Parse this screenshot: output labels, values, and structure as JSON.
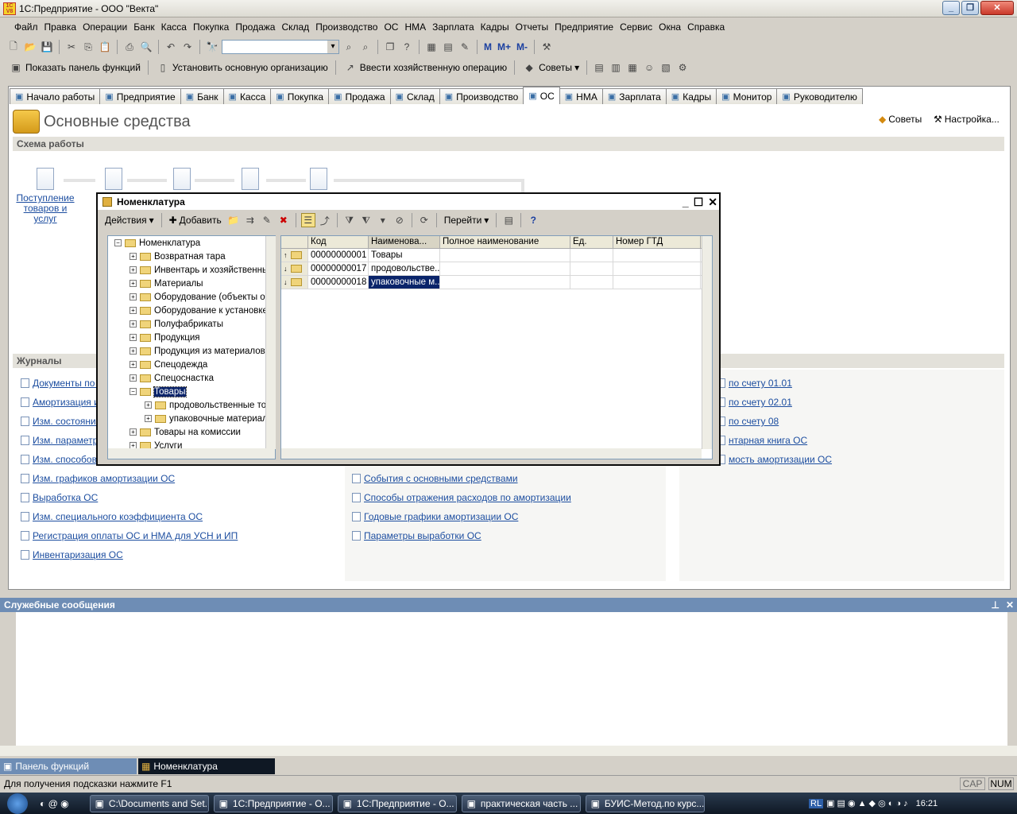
{
  "window": {
    "title": "1С:Предприятие - ООО \"Векта\""
  },
  "menu": [
    "Файл",
    "Правка",
    "Операции",
    "Банк",
    "Касса",
    "Покупка",
    "Продажа",
    "Склад",
    "Производство",
    "ОС",
    "НМА",
    "Зарплата",
    "Кадры",
    "Отчеты",
    "Предприятие",
    "Сервис",
    "Окна",
    "Справка"
  ],
  "toolbar2": {
    "show_panel": "Показать панель функций",
    "set_org": "Установить основную организацию",
    "enter_op": "Ввести хозяйственную операцию",
    "tips": "Советы"
  },
  "toolbar1": {
    "m": "М",
    "mplus": "М+",
    "mminus": "М-"
  },
  "tabs": [
    "Начало работы",
    "Предприятие",
    "Банк",
    "Касса",
    "Покупка",
    "Продажа",
    "Склад",
    "Производство",
    "ОС",
    "НМА",
    "Зарплата",
    "Кадры",
    "Монитор",
    "Руководителю"
  ],
  "page": {
    "title": "Основные средства",
    "tips": "Советы",
    "settings": "Настройка...",
    "scheme": "Схема работы",
    "journals": "Журналы"
  },
  "scheme": [
    "Поступление товаров и услуг"
  ],
  "journals_left": [
    "Документы по О",
    "Амортизация и",
    "Изм. состояния",
    "Изм. параметро",
    "Изм. способов",
    "Изм. графиков амортизации ОС",
    "Выработка ОС",
    "Изм. специального коэффициента ОС",
    "Регистрация оплаты ОС и НМА для УСН и ИП",
    "Инвентаризация ОС"
  ],
  "journals_mid": [
    "События с основными средствами",
    "Способы отражения расходов по амортизации",
    "Годовые графики амортизации ОС",
    "Параметры выработки ОС"
  ],
  "journals_right": [
    "по счету 01.01",
    "по счету 02.01",
    "по счету 08",
    "нтарная книга ОС",
    "мость амортизации ОС"
  ],
  "dialog": {
    "title": "Номенклатура",
    "actions": "Действия",
    "add": "Добавить",
    "goto": "Перейти",
    "tree": [
      {
        "label": "Номенклатура",
        "level": 0,
        "sign": "−"
      },
      {
        "label": "Возвратная тара",
        "level": 1,
        "sign": "+"
      },
      {
        "label": "Инвентарь и хозяйственные",
        "level": 1,
        "sign": "+"
      },
      {
        "label": "Материалы",
        "level": 1,
        "sign": "+"
      },
      {
        "label": "Оборудование (объекты ос",
        "level": 1,
        "sign": "+"
      },
      {
        "label": "Оборудование к установке",
        "level": 1,
        "sign": "+"
      },
      {
        "label": "Полуфабрикаты",
        "level": 1,
        "sign": "+"
      },
      {
        "label": "Продукция",
        "level": 1,
        "sign": "+"
      },
      {
        "label": "Продукция из материалов",
        "level": 1,
        "sign": "+"
      },
      {
        "label": "Спецодежда",
        "level": 1,
        "sign": "+"
      },
      {
        "label": "Спецоснастка",
        "level": 1,
        "sign": "+"
      },
      {
        "label": "Товары",
        "level": 1,
        "sign": "−",
        "selected": true
      },
      {
        "label": "продовольственные то",
        "level": 2,
        "sign": "+"
      },
      {
        "label": "упаковочные материал",
        "level": 2,
        "sign": "+"
      },
      {
        "label": "Товары на комиссии",
        "level": 1,
        "sign": "+"
      },
      {
        "label": "Услуги",
        "level": 1,
        "sign": "+"
      }
    ],
    "columns": [
      "Код",
      "Наименова...",
      "Полное наименование",
      "Ед.",
      "Номер ГТД"
    ],
    "rows": [
      {
        "arrow": "↑",
        "code": "00000000001",
        "name": "Товары",
        "full": "",
        "unit": "",
        "gtd": ""
      },
      {
        "arrow": "↓",
        "code": "00000000017",
        "name": "продовольстве...",
        "full": "",
        "unit": "",
        "gtd": ""
      },
      {
        "arrow": "↓",
        "code": "00000000018",
        "name": "упаковочные м...",
        "full": "",
        "unit": "",
        "gtd": "",
        "selected": true
      }
    ]
  },
  "service": {
    "title": "Служебные сообщения"
  },
  "window_panel": {
    "functions": "Панель функций",
    "nomen": "Номенклатура"
  },
  "status": {
    "hint": "Для получения подсказки нажмите F1",
    "cap": "CAP",
    "num": "NUM"
  },
  "taskbar": {
    "items": [
      "C:\\Documents and Set...",
      "1С:Предприятие - О...",
      "1С:Предприятие - О...",
      "практическая часть ...",
      "БУИС-Метод.по курс..."
    ],
    "lang": "RL",
    "clock": "16:21"
  },
  "colors": {
    "selection": "#0a246a",
    "link": "#1d4ea0",
    "service_bar": "#6e8db5"
  }
}
